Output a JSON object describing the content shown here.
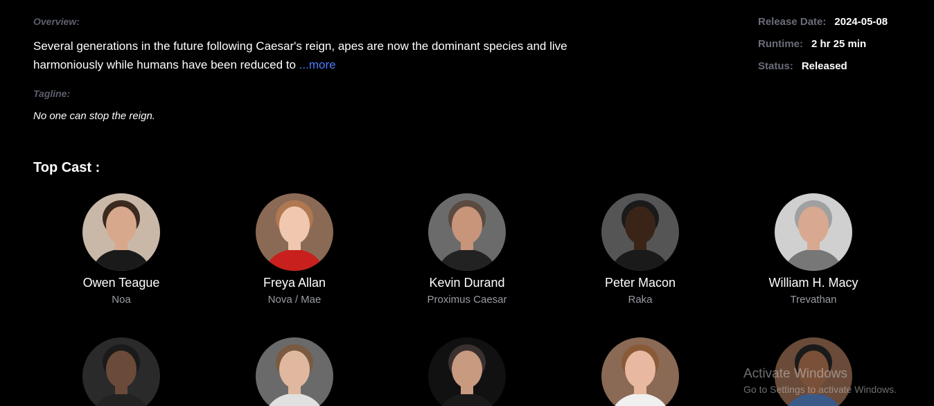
{
  "overview": {
    "label": "Overview:",
    "text": "Several generations in the future following Caesar's reign, apes are now the dominant species and live harmoniously while humans have been reduced to ",
    "more_link": "...more"
  },
  "tagline": {
    "label": "Tagline:",
    "text": "No one can stop the reign."
  },
  "meta": {
    "release_label": "Release Date:",
    "release_value": "2024-05-08",
    "runtime_label": "Runtime:",
    "runtime_value": "2 hr 25 min",
    "status_label": "Status:",
    "status_value": "Released"
  },
  "top_cast": {
    "title": "Top Cast :",
    "row1": [
      {
        "name": "Owen Teague",
        "role": "Noa",
        "bg": "#c9b8a8",
        "skin": "#d8a88c",
        "hair": "#3a2a20",
        "shirt": "#1a1a1a"
      },
      {
        "name": "Freya Allan",
        "role": "Nova / Mae",
        "bg": "#8a6a55",
        "skin": "#f0c8b0",
        "hair": "#b07850",
        "shirt": "#c8201c"
      },
      {
        "name": "Kevin Durand",
        "role": "Proximus Caesar",
        "bg": "#6b6b6b",
        "skin": "#c8957a",
        "hair": "#5a4a40",
        "shirt": "#222222"
      },
      {
        "name": "Peter Macon",
        "role": "Raka",
        "bg": "#555555",
        "skin": "#3a2418",
        "hair": "#1a1a1a",
        "shirt": "#1a1a1a"
      },
      {
        "name": "William H. Macy",
        "role": "Trevathan",
        "bg": "#d0d0d0",
        "skin": "#d8a890",
        "hair": "#a0a0a0",
        "shirt": "#777777"
      }
    ],
    "row2": [
      {
        "bg": "#2a2a2a",
        "skin": "#6a4a38",
        "hair": "#1a1a1a",
        "shirt": "#222222"
      },
      {
        "bg": "#6a6a6a",
        "skin": "#e0b8a0",
        "hair": "#7a5a40",
        "shirt": "#e0e0e0"
      },
      {
        "bg": "#111111",
        "skin": "#c89a80",
        "hair": "#3a3030",
        "shirt": "#1a1a1a"
      },
      {
        "bg": "#8a6a55",
        "skin": "#e8b8a0",
        "hair": "#8a5a38",
        "shirt": "#f0f0f0"
      },
      {
        "bg": "#6a4a38",
        "skin": "#7a5038",
        "hair": "#1a1a1a",
        "shirt": "#3a5a8a"
      }
    ]
  },
  "watermark": {
    "title": "Activate Windows",
    "subtitle": "Go to Settings to activate Windows."
  }
}
